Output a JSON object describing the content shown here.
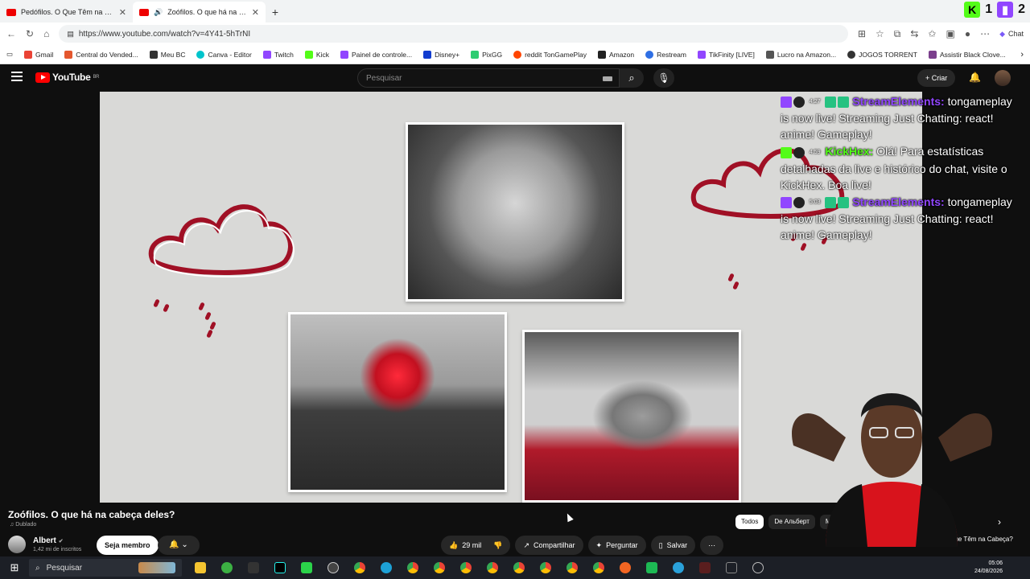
{
  "browser": {
    "tabs": [
      {
        "title": "Pedófilos. O Que Têm na Cabeça?",
        "active": false
      },
      {
        "title": "Zoófilos. O que há na cabeça",
        "active": true
      }
    ],
    "new_tab": "+",
    "extensions": {
      "kick_count": "1",
      "twitch_count": "2"
    },
    "url": "https://www.youtube.com/watch?v=4Y41-5hTrNI",
    "chat_label": "Chat",
    "bookmarks": [
      {
        "label": "Gmail",
        "color": "#ea4335"
      },
      {
        "label": "Central do Vended...",
        "color": "#e4572e"
      },
      {
        "label": "Meu BC",
        "color": "#333333"
      },
      {
        "label": "Canva - Editor",
        "color": "#00c4cc"
      },
      {
        "label": "Twitch",
        "color": "#9146ff"
      },
      {
        "label": "Kick",
        "color": "#53fc18"
      },
      {
        "label": "Painel de controle...",
        "color": "#9146ff"
      },
      {
        "label": "Disney+",
        "color": "#113ccf"
      },
      {
        "label": "PixGG",
        "color": "#2ecc71"
      },
      {
        "label": "reddit TonGamePlay",
        "color": "#ff4500"
      },
      {
        "label": "Amazon",
        "color": "#222222"
      },
      {
        "label": "Restream",
        "color": "#2f6fe4"
      },
      {
        "label": "TikFinity [LIVE]",
        "color": "#9146ff"
      },
      {
        "label": "Lucro na Amazon...",
        "color": "#555555"
      },
      {
        "label": "JOGOS TORRENT",
        "color": "#333333"
      },
      {
        "label": "Assistir Black Clove...",
        "color": "#7b3f8c"
      }
    ]
  },
  "youtube": {
    "logo_text": "YouTube",
    "region": "BR",
    "search_placeholder": "Pesquisar",
    "create_label": "+ Criar"
  },
  "chat": [
    {
      "time": "4:27",
      "platform": "twitch",
      "user": "StreamElements:",
      "text": "tongameplay is now live! Streaming Just Chatting: react! anime! Gameplay!"
    },
    {
      "time": "4:59",
      "platform": "kick",
      "user": "KickHex:",
      "text": "Olá! Para estatísticas detalhadas da live e histórico do chat, visite o KickHex. Boa live!"
    },
    {
      "time": "5:03",
      "platform": "twitch",
      "user": "StreamElements:",
      "text": "tongameplay is now live! Streaming Just Chatting: react! anime! Gameplay!"
    }
  ],
  "video": {
    "title": "Zoófilos. O que há na cabeça deles?",
    "dubbed": "Dublado",
    "channel": "Albert",
    "subscribers": "1,42 mi de inscritos",
    "member_label": "Seja membro",
    "likes": "29 mil",
    "share_label": "Compartilhar",
    "ask_label": "Perguntar",
    "save_label": "Salvar"
  },
  "recommend": {
    "chips": [
      {
        "label": "Todos",
        "selected": true
      },
      {
        "label": "De Альберт",
        "selected": false
      },
      {
        "label": "Mais recentes",
        "selected": false
      }
    ],
    "side_title": "que Têm na Cabeça?"
  },
  "taskbar": {
    "search_placeholder": "Pesquisar",
    "time": "05:06",
    "date": "24/08/2026"
  }
}
